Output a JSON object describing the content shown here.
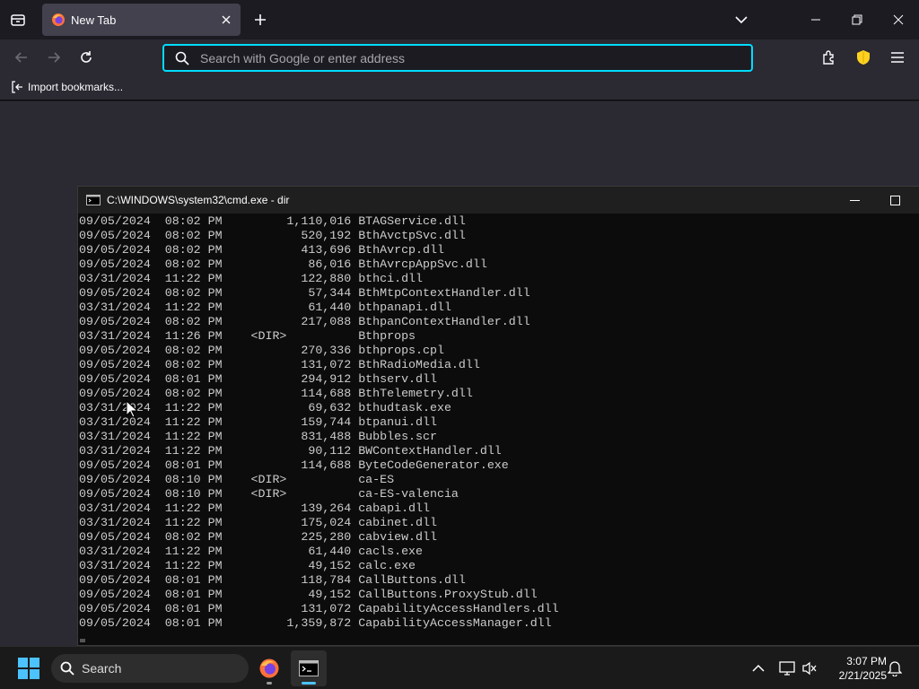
{
  "browser": {
    "tab_title": "New Tab",
    "url_placeholder": "Search with Google or enter address",
    "bookmark_label": "Import bookmarks..."
  },
  "cmd": {
    "title": "C:\\WINDOWS\\system32\\cmd.exe - dir",
    "lines": [
      "09/05/2024  08:02 PM         1,110,016 BTAGService.dll",
      "09/05/2024  08:02 PM           520,192 BthAvctpSvc.dll",
      "09/05/2024  08:02 PM           413,696 BthAvrcp.dll",
      "09/05/2024  08:02 PM            86,016 BthAvrcpAppSvc.dll",
      "03/31/2024  11:22 PM           122,880 bthci.dll",
      "09/05/2024  08:02 PM            57,344 BthMtpContextHandler.dll",
      "03/31/2024  11:22 PM            61,440 bthpanapi.dll",
      "09/05/2024  08:02 PM           217,088 BthpanContextHandler.dll",
      "03/31/2024  11:26 PM    <DIR>          Bthprops",
      "09/05/2024  08:02 PM           270,336 bthprops.cpl",
      "09/05/2024  08:02 PM           131,072 BthRadioMedia.dll",
      "09/05/2024  08:01 PM           294,912 bthserv.dll",
      "09/05/2024  08:02 PM           114,688 BthTelemetry.dll",
      "03/31/2024  11:22 PM            69,632 bthudtask.exe",
      "03/31/2024  11:22 PM           159,744 btpanui.dll",
      "03/31/2024  11:22 PM           831,488 Bubbles.scr",
      "03/31/2024  11:22 PM            90,112 BWContextHandler.dll",
      "09/05/2024  08:01 PM           114,688 ByteCodeGenerator.exe",
      "09/05/2024  08:10 PM    <DIR>          ca-ES",
      "09/05/2024  08:10 PM    <DIR>          ca-ES-valencia",
      "03/31/2024  11:22 PM           139,264 cabapi.dll",
      "03/31/2024  11:22 PM           175,024 cabinet.dll",
      "09/05/2024  08:02 PM           225,280 cabview.dll",
      "03/31/2024  11:22 PM            61,440 cacls.exe",
      "03/31/2024  11:22 PM            49,152 calc.exe",
      "09/05/2024  08:01 PM           118,784 CallButtons.dll",
      "09/05/2024  08:01 PM            49,152 CallButtons.ProxyStub.dll",
      "09/05/2024  08:01 PM           131,072 CapabilityAccessHandlers.dll",
      "09/05/2024  08:01 PM         1,359,872 CapabilityAccessManager.dll"
    ]
  },
  "taskbar": {
    "search_label": "Search",
    "time": "3:07 PM",
    "date": "2/21/2025"
  },
  "colors": {
    "accent_focus": "#00ddff",
    "shield": "#ffd21f",
    "firefox_orange": "#ff7139"
  },
  "icons": [
    "tab-list-icon",
    "firefox-icon",
    "close-icon",
    "plus-icon",
    "chevron-down-icon",
    "minimize-icon",
    "restore-icon",
    "back-icon",
    "forward-icon",
    "reload-icon",
    "search-icon",
    "extensions-icon",
    "shield-icon",
    "menu-icon",
    "import-icon",
    "cmd-icon",
    "maximize-icon",
    "windows-logo-icon",
    "terminal-icon",
    "chevron-up-icon",
    "display-icon",
    "volume-muted-icon",
    "bell-icon"
  ]
}
